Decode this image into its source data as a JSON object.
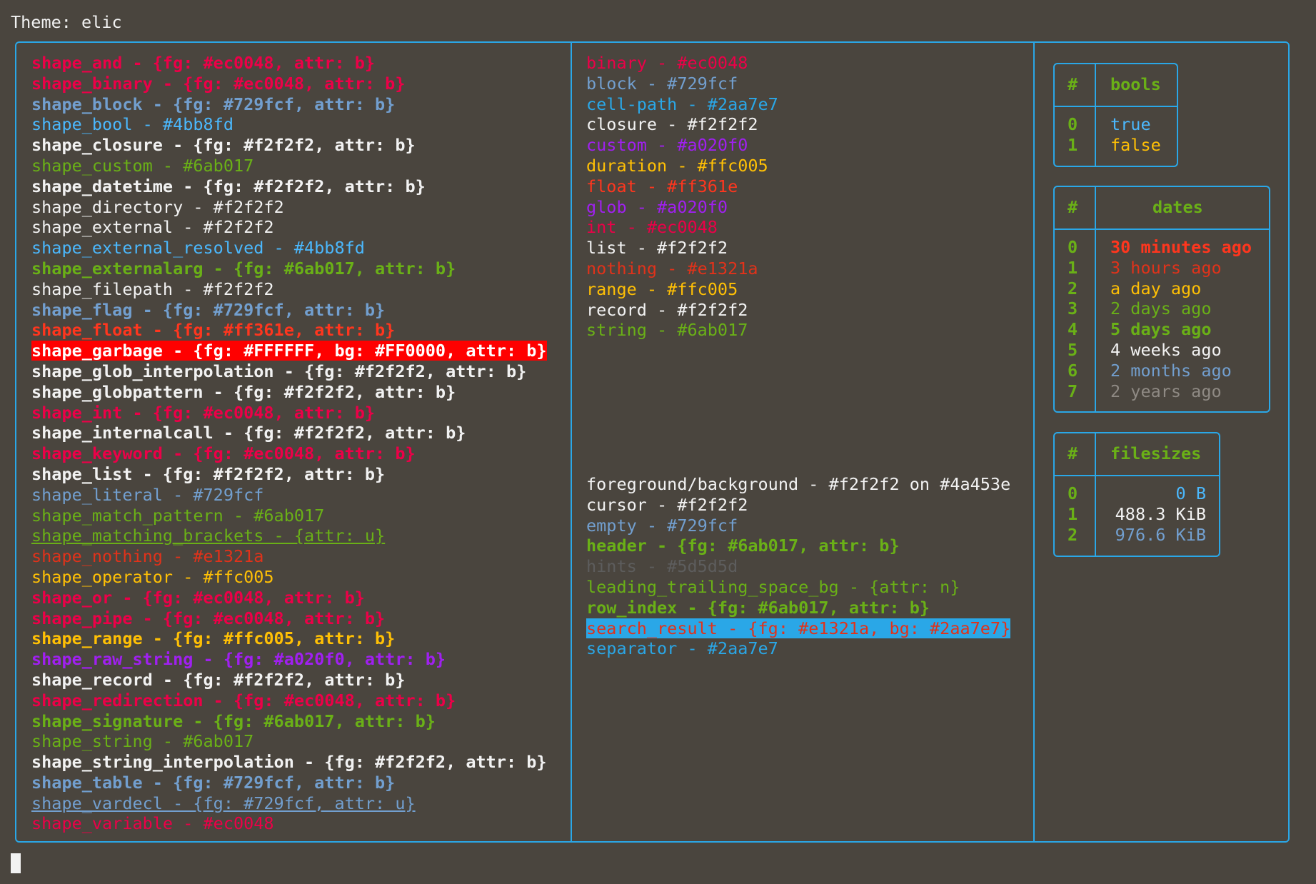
{
  "terminal": {
    "title": "Theme: elic",
    "background": "#4a453e",
    "foreground": "#f2f2f2",
    "border_color": "#2aa7e7"
  },
  "shapes": [
    {
      "text": "shape_and - {fg: #ec0048, attr: b}",
      "color": "#ec0048",
      "bold": true
    },
    {
      "text": "shape_binary - {fg: #ec0048, attr: b}",
      "color": "#ec0048",
      "bold": true
    },
    {
      "text": "shape_block - {fg: #729fcf, attr: b}",
      "color": "#729fcf",
      "bold": true
    },
    {
      "text": "shape_bool - #4bb8fd",
      "color": "#4bb8fd"
    },
    {
      "text": "shape_closure - {fg: #f2f2f2, attr: b}",
      "color": "#f2f2f2",
      "bold": true
    },
    {
      "text": "shape_custom - #6ab017",
      "color": "#6ab017"
    },
    {
      "text": "shape_datetime - {fg: #f2f2f2, attr: b}",
      "color": "#f2f2f2",
      "bold": true
    },
    {
      "text": "shape_directory - #f2f2f2",
      "color": "#f2f2f2"
    },
    {
      "text": "shape_external - #f2f2f2",
      "color": "#f2f2f2"
    },
    {
      "text": "shape_external_resolved - #4bb8fd",
      "color": "#4bb8fd"
    },
    {
      "text": "shape_externalarg - {fg: #6ab017, attr: b}",
      "color": "#6ab017",
      "bold": true
    },
    {
      "text": "shape_filepath - #f2f2f2",
      "color": "#f2f2f2"
    },
    {
      "text": "shape_flag - {fg: #729fcf, attr: b}",
      "color": "#729fcf",
      "bold": true
    },
    {
      "text": "shape_float - {fg: #ff361e, attr: b}",
      "color": "#ff361e",
      "bold": true
    },
    {
      "text": "shape_garbage - {fg: #FFFFFF, bg: #FF0000, attr: b}",
      "color": "#FFFFFF",
      "bg": "#FF0000",
      "bold": true
    },
    {
      "text": "shape_glob_interpolation - {fg: #f2f2f2, attr: b}",
      "color": "#f2f2f2",
      "bold": true
    },
    {
      "text": "shape_globpattern - {fg: #f2f2f2, attr: b}",
      "color": "#f2f2f2",
      "bold": true
    },
    {
      "text": "shape_int - {fg: #ec0048, attr: b}",
      "color": "#ec0048",
      "bold": true
    },
    {
      "text": "shape_internalcall - {fg: #f2f2f2, attr: b}",
      "color": "#f2f2f2",
      "bold": true
    },
    {
      "text": "shape_keyword - {fg: #ec0048, attr: b}",
      "color": "#ec0048",
      "bold": true
    },
    {
      "text": "shape_list - {fg: #f2f2f2, attr: b}",
      "color": "#f2f2f2",
      "bold": true
    },
    {
      "text": "shape_literal - #729fcf",
      "color": "#729fcf"
    },
    {
      "text": "shape_match_pattern - #6ab017",
      "color": "#6ab017"
    },
    {
      "text": "shape_matching_brackets - {attr: u}",
      "color": "#6ab017",
      "underline": true
    },
    {
      "text": "shape_nothing - #e1321a",
      "color": "#e1321a"
    },
    {
      "text": "shape_operator - #ffc005",
      "color": "#ffc005"
    },
    {
      "text": "shape_or - {fg: #ec0048, attr: b}",
      "color": "#ec0048",
      "bold": true
    },
    {
      "text": "shape_pipe - {fg: #ec0048, attr: b}",
      "color": "#ec0048",
      "bold": true
    },
    {
      "text": "shape_range - {fg: #ffc005, attr: b}",
      "color": "#ffc005",
      "bold": true
    },
    {
      "text": "shape_raw_string - {fg: #a020f0, attr: b}",
      "color": "#a020f0",
      "bold": true
    },
    {
      "text": "shape_record - {fg: #f2f2f2, attr: b}",
      "color": "#f2f2f2",
      "bold": true
    },
    {
      "text": "shape_redirection - {fg: #ec0048, attr: b}",
      "color": "#ec0048",
      "bold": true
    },
    {
      "text": "shape_signature - {fg: #6ab017, attr: b}",
      "color": "#6ab017",
      "bold": true
    },
    {
      "text": "shape_string - #6ab017",
      "color": "#6ab017"
    },
    {
      "text": "shape_string_interpolation - {fg: #f2f2f2, attr: b}",
      "color": "#f2f2f2",
      "bold": true
    },
    {
      "text": "shape_table - {fg: #729fcf, attr: b}",
      "color": "#729fcf",
      "bold": true
    },
    {
      "text": "shape_vardecl - {fg: #729fcf, attr: u}",
      "color": "#729fcf",
      "underline": true
    },
    {
      "text": "shape_variable - #ec0048",
      "color": "#ec0048"
    }
  ],
  "types": [
    {
      "text": "binary - #ec0048",
      "color": "#ec0048"
    },
    {
      "text": "block - #729fcf",
      "color": "#729fcf"
    },
    {
      "text": "cell-path - #2aa7e7",
      "color": "#2aa7e7"
    },
    {
      "text": "closure - #f2f2f2",
      "color": "#f2f2f2"
    },
    {
      "text": "custom - #a020f0",
      "color": "#a020f0"
    },
    {
      "text": "duration - #ffc005",
      "color": "#ffc005"
    },
    {
      "text": "float - #ff361e",
      "color": "#ff361e"
    },
    {
      "text": "glob - #a020f0",
      "color": "#a020f0"
    },
    {
      "text": "int - #ec0048",
      "color": "#ec0048"
    },
    {
      "text": "list - #f2f2f2",
      "color": "#f2f2f2"
    },
    {
      "text": "nothing - #e1321a",
      "color": "#e1321a"
    },
    {
      "text": "range - #ffc005",
      "color": "#ffc005"
    },
    {
      "text": "record - #f2f2f2",
      "color": "#f2f2f2"
    },
    {
      "text": "string - #6ab017",
      "color": "#6ab017"
    }
  ],
  "ui_colors": [
    {
      "text": "foreground/background - #f2f2f2 on #4a453e",
      "color": "#f2f2f2"
    },
    {
      "text": "cursor - #f2f2f2",
      "color": "#f2f2f2"
    },
    {
      "text": "empty - #729fcf",
      "color": "#729fcf"
    },
    {
      "text": "header - {fg: #6ab017, attr: b}",
      "color": "#6ab017",
      "bold": true
    },
    {
      "text": "hints - #5d5d5d",
      "color": "#5d5d5d"
    },
    {
      "text": "leading_trailing_space_bg - {attr: n}",
      "color": "#6ab017"
    },
    {
      "text": "row_index - {fg: #6ab017, attr: b}",
      "color": "#6ab017",
      "bold": true
    },
    {
      "text": "search_result - {fg: #e1321a, bg: #2aa7e7}",
      "color": "#e1321a",
      "bg": "#2aa7e7"
    },
    {
      "text": "separator - #2aa7e7",
      "color": "#2aa7e7"
    }
  ],
  "bools_table": {
    "headers": [
      "#",
      "bools"
    ],
    "rows": [
      {
        "index": "0",
        "value": "true",
        "color": "#4bb8fd"
      },
      {
        "index": "1",
        "value": "false",
        "color": "#ffc005"
      }
    ]
  },
  "dates_table": {
    "headers": [
      "#",
      "dates"
    ],
    "rows": [
      {
        "index": "0",
        "value": "30 minutes ago",
        "color": "#ff361e",
        "bold": true
      },
      {
        "index": "1",
        "value": "3 hours ago",
        "color": "#e1321a"
      },
      {
        "index": "2",
        "value": "a day ago",
        "color": "#ffc005"
      },
      {
        "index": "3",
        "value": "2 days ago",
        "color": "#6ab017"
      },
      {
        "index": "4",
        "value": "5 days ago",
        "color": "#6ab017",
        "bold": true
      },
      {
        "index": "5",
        "value": "4 weeks ago",
        "color": "#f2f2f2"
      },
      {
        "index": "6",
        "value": "2 months ago",
        "color": "#729fcf"
      },
      {
        "index": "7",
        "value": "2 years ago",
        "color": "#8f8a84"
      }
    ]
  },
  "filesizes_table": {
    "headers": [
      "#",
      "filesizes"
    ],
    "rows": [
      {
        "index": "0",
        "value": "0 B",
        "color": "#4bb8fd"
      },
      {
        "index": "1",
        "value": "488.3 KiB",
        "color": "#f2f2f2"
      },
      {
        "index": "2",
        "value": "976.6 KiB",
        "color": "#729fcf"
      }
    ]
  }
}
